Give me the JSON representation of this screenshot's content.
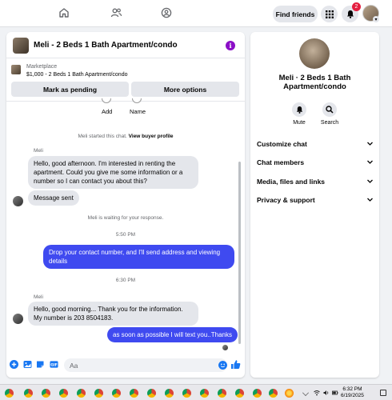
{
  "topnav": {
    "find_friends_label": "Find friends",
    "notification_count": "2",
    "icons": [
      "home-icon",
      "friends-icon",
      "groups-icon",
      "menu-grid-icon",
      "bell-icon"
    ]
  },
  "chat": {
    "title": "Meli - 2 Beds 1 Bath Apartment/condo",
    "marketplace_label": "Marketplace",
    "listing_text": "$1,000 - 2 Beds 1 Bath Apartment/condo",
    "mark_pending_label": "Mark as pending",
    "more_options_label": "More options",
    "partial_actions": [
      "Add",
      "Name"
    ],
    "started_note": "Meli started this chat.",
    "view_buyer_profile": "View buyer profile",
    "sender_name": "Meli",
    "messages": [
      {
        "from": "Meli",
        "text": "Hello, good afternoon. I'm interested in renting the apartment. Could you give me some information or a number so I can contact you about this?"
      },
      {
        "from": "Meli",
        "text": "Message sent"
      },
      {
        "from": "me",
        "text": "Drop your contact number, and I'll send address and viewing details"
      },
      {
        "from": "Meli",
        "text": "Hello, good morning... Thank you for the information. My number is 203 8504183."
      },
      {
        "from": "me",
        "text": "as soon as possible I will text you..Thanks"
      }
    ],
    "waiting_note": "Meli is waiting for your response.",
    "time_1": "5:50 PM",
    "time_2": "6:30 PM",
    "composer_placeholder": "Aa"
  },
  "details": {
    "title": "Meli · 2 Beds 1 Bath Apartment/condo",
    "mute_label": "Mute",
    "search_label": "Search",
    "sections": [
      "Customize chat",
      "Chat members",
      "Media, files and links",
      "Privacy & support"
    ]
  },
  "taskbar": {
    "time": "6:32 PM",
    "date": "6/19/2025"
  },
  "colors": {
    "accent_blue": "#3f4af0",
    "facebook_blue": "#1877f2",
    "info_purple": "#8b0ec7",
    "badge_red": "#e41e3f"
  }
}
